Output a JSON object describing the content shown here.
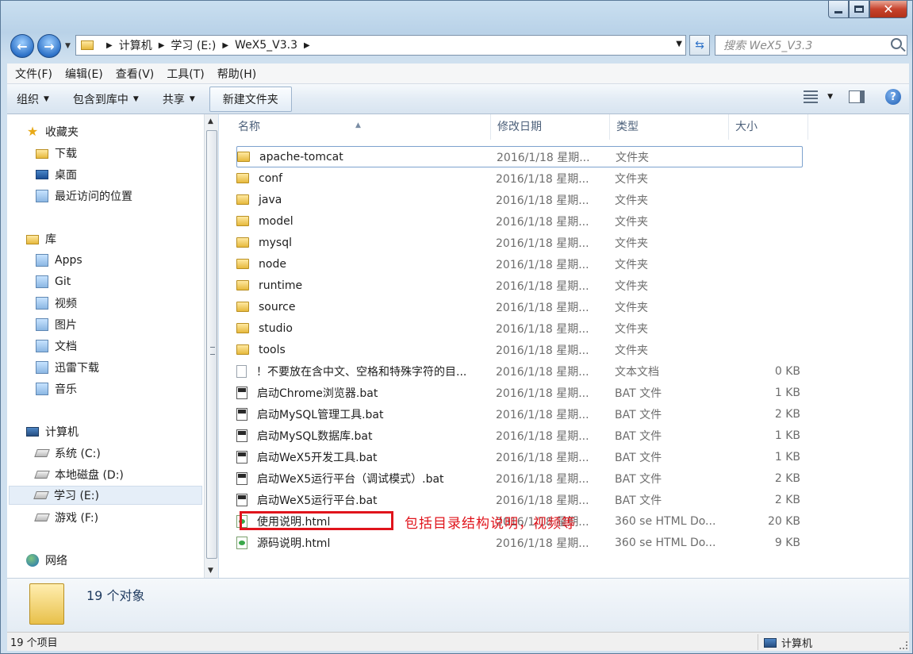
{
  "address": {
    "crumbs": [
      "计算机",
      "学习 (E:)",
      "WeX5_V3.3"
    ]
  },
  "search": {
    "placeholder": "搜索 WeX5_V3.3"
  },
  "menu": [
    "文件(F)",
    "编辑(E)",
    "查看(V)",
    "工具(T)",
    "帮助(H)"
  ],
  "toolbar": {
    "organize": "组织",
    "include_library": "包含到库中",
    "share": "共享",
    "new_folder": "新建文件夹"
  },
  "sidebar": {
    "favorites": {
      "label": "收藏夹",
      "items": [
        "下载",
        "桌面",
        "最近访问的位置"
      ]
    },
    "libraries": {
      "label": "库",
      "items": [
        "Apps",
        "Git",
        "视频",
        "图片",
        "文档",
        "迅雷下载",
        "音乐"
      ]
    },
    "computer": {
      "label": "计算机",
      "items": [
        "系统 (C:)",
        "本地磁盘 (D:)",
        "学习 (E:)",
        "游戏 (F:)"
      ]
    },
    "network": {
      "label": "网络"
    }
  },
  "columns": {
    "name": "名称",
    "date": "修改日期",
    "type": "类型",
    "size": "大小"
  },
  "files": [
    {
      "name": "apache-tomcat",
      "date": "2016/1/18 星期...",
      "type": "文件夹",
      "size": "",
      "icon": "folder"
    },
    {
      "name": "conf",
      "date": "2016/1/18 星期...",
      "type": "文件夹",
      "size": "",
      "icon": "folder"
    },
    {
      "name": "java",
      "date": "2016/1/18 星期...",
      "type": "文件夹",
      "size": "",
      "icon": "folder"
    },
    {
      "name": "model",
      "date": "2016/1/18 星期...",
      "type": "文件夹",
      "size": "",
      "icon": "folder"
    },
    {
      "name": "mysql",
      "date": "2016/1/18 星期...",
      "type": "文件夹",
      "size": "",
      "icon": "folder"
    },
    {
      "name": "node",
      "date": "2016/1/18 星期...",
      "type": "文件夹",
      "size": "",
      "icon": "folder"
    },
    {
      "name": "runtime",
      "date": "2016/1/18 星期...",
      "type": "文件夹",
      "size": "",
      "icon": "folder"
    },
    {
      "name": "source",
      "date": "2016/1/18 星期...",
      "type": "文件夹",
      "size": "",
      "icon": "folder"
    },
    {
      "name": "studio",
      "date": "2016/1/18 星期...",
      "type": "文件夹",
      "size": "",
      "icon": "folder"
    },
    {
      "name": "tools",
      "date": "2016/1/18 星期...",
      "type": "文件夹",
      "size": "",
      "icon": "folder"
    },
    {
      "name": "！不要放在含中文、空格和特殊字符的目...",
      "date": "2016/1/18 星期...",
      "type": "文本文档",
      "size": "0 KB",
      "icon": "txt"
    },
    {
      "name": "启动Chrome浏览器.bat",
      "date": "2016/1/18 星期...",
      "type": "BAT 文件",
      "size": "1 KB",
      "icon": "bat"
    },
    {
      "name": "启动MySQL管理工具.bat",
      "date": "2016/1/18 星期...",
      "type": "BAT 文件",
      "size": "2 KB",
      "icon": "bat"
    },
    {
      "name": "启动MySQL数据库.bat",
      "date": "2016/1/18 星期...",
      "type": "BAT 文件",
      "size": "1 KB",
      "icon": "bat"
    },
    {
      "name": "启动WeX5开发工具.bat",
      "date": "2016/1/18 星期...",
      "type": "BAT 文件",
      "size": "1 KB",
      "icon": "bat"
    },
    {
      "name": "启动WeX5运行平台（调试模式）.bat",
      "date": "2016/1/18 星期...",
      "type": "BAT 文件",
      "size": "2 KB",
      "icon": "bat"
    },
    {
      "name": "启动WeX5运行平台.bat",
      "date": "2016/1/18 星期...",
      "type": "BAT 文件",
      "size": "2 KB",
      "icon": "bat"
    },
    {
      "name": "使用说明.html",
      "date": "2016/1/18 星期...",
      "type": "360 se HTML Do...",
      "size": "20 KB",
      "icon": "html"
    },
    {
      "name": "源码说明.html",
      "date": "2016/1/18 星期...",
      "type": "360 se HTML Do...",
      "size": "9 KB",
      "icon": "html"
    }
  ],
  "annotation": "包括目录结构说明，视频等",
  "details": {
    "count": "19 个对象"
  },
  "status": {
    "items": "19 个项目",
    "location": "计算机"
  }
}
